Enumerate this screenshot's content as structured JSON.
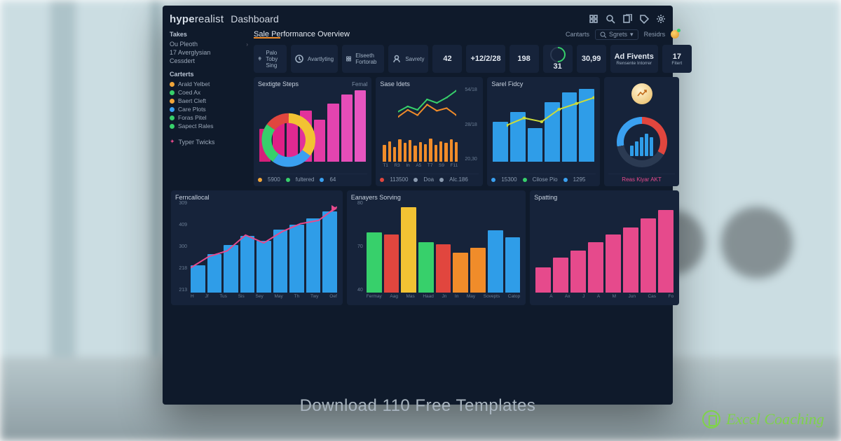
{
  "brand": {
    "prefix": "hype",
    "mid": "realist"
  },
  "title": "Dashboard",
  "subtitle": "Sale Performance Overview",
  "header_right": {
    "link1": "Cantarts",
    "search_label": "Sgrets",
    "link2": "Residrs"
  },
  "sidebar": {
    "sec1_title": "Takes",
    "sec1_items": [
      "Ou Pleoth",
      "17 Averglysian",
      "Cessdert"
    ],
    "sec2_title": "Carterts",
    "legend_items": [
      {
        "label": "Arald Yelbet",
        "color": "#f0a53a"
      },
      {
        "label": "Coed Ax",
        "color": "#37d06b"
      },
      {
        "label": "Baert Cleft",
        "color": "#f0a53a"
      },
      {
        "label": "Care Plots",
        "color": "#3aa0f0"
      },
      {
        "label": "Foras Pitel",
        "color": "#37d06b"
      },
      {
        "label": "Sapect Rales",
        "color": "#37d06b"
      }
    ],
    "footer_item": "Typer Twicks"
  },
  "kpis": [
    {
      "icon": "pin",
      "label": "Palo Toby Sing"
    },
    {
      "icon": "clock",
      "label": "Avartlyting"
    },
    {
      "icon": "grid",
      "label": "Elseeth Fortorab"
    },
    {
      "icon": "user",
      "label": "Savrety"
    },
    {
      "big": "42",
      "sub": ""
    },
    {
      "big": "+12/2/28",
      "sub": ""
    },
    {
      "big": "198",
      "sub": ""
    },
    {
      "gauge": true,
      "big": "31",
      "sub": ""
    },
    {
      "big": "30,99",
      "sub": ""
    },
    {
      "big": "Ad Fivents",
      "sub": "Rensente Intorrer"
    },
    {
      "big": "17",
      "sub": "Fitert"
    }
  ],
  "panels": {
    "p1": {
      "title": "Sextigte Steps",
      "right": "Femal",
      "foot": [
        {
          "c": "#f0a53a",
          "t": "5900"
        },
        {
          "c": "#37d06b",
          "t": "fultered"
        },
        {
          "c": "#3aa0f0",
          "t": "64"
        }
      ]
    },
    "p2": {
      "title": "Sase Idets",
      "foot": [
        {
          "c": "#e1463e",
          "t": "113500"
        },
        {
          "c": "#8b9bb0",
          "t": "Doa"
        },
        {
          "c": "#8b9bb0",
          "t": "Alc.186"
        }
      ]
    },
    "p3": {
      "title": "Sarel Fidcy",
      "foot": [
        {
          "c": "#3aa0f0",
          "t": "15300"
        },
        {
          "c": "#37d06b",
          "t": "Cilose Pio"
        },
        {
          "c": "#3aa0f0",
          "t": "1295"
        }
      ]
    },
    "p4": {
      "title": "",
      "foot_text": "Reas Kiyar AKT"
    },
    "p5": {
      "title": "Ferncallocal"
    },
    "p6": {
      "title": "Eanayers Sorving"
    },
    "p7": {
      "title": "Spatting"
    }
  },
  "banner": "Download  110  Free Templates",
  "brandmark": "Excel Coaching",
  "colors": {
    "pink": "#e64a8c",
    "blue": "#2f9de8",
    "orange": "#f08c2a",
    "red": "#e1463e",
    "green": "#37d06b",
    "yellow": "#f2c233",
    "teal": "#2bb8a3",
    "lime": "#8bc34a"
  },
  "chart_data": [
    {
      "id": "p1_bars",
      "type": "bar",
      "title": "Sextigte Steps",
      "values": [
        45,
        55,
        62,
        70,
        58,
        80,
        92,
        98
      ],
      "ylim": [
        0,
        100
      ],
      "colors_from": "pink_gradient",
      "overlay_donut": {
        "slices": [
          35,
          25,
          25,
          15
        ],
        "colors": [
          "#f2c233",
          "#3aa0f0",
          "#37d06b",
          "#e1463e"
        ]
      }
    },
    {
      "id": "p2_lines",
      "type": "line",
      "title": "Sase Idets",
      "x": [
        "T1",
        "R3",
        "In",
        "A5",
        "T7",
        "S9",
        "F11"
      ],
      "series": [
        {
          "name": "green",
          "values": [
            34,
            40,
            36,
            48,
            44,
            50,
            58
          ],
          "color": "#37d06b"
        },
        {
          "name": "orange",
          "values": [
            28,
            36,
            30,
            42,
            35,
            38,
            30
          ],
          "color": "#f08c2a"
        }
      ],
      "ylabels": [
        "54/18",
        "28/18",
        "20,30"
      ],
      "ylim": [
        20,
        60
      ],
      "bars_below": {
        "values": [
          18,
          22,
          16,
          24,
          20,
          23,
          17,
          21,
          19,
          25,
          18,
          22,
          20,
          24,
          21
        ],
        "color": "#f08c2a"
      }
    },
    {
      "id": "p3_combo",
      "type": "bar",
      "title": "Sarel Fidcy",
      "values": [
        55,
        68,
        46,
        82,
        95,
        100
      ],
      "ylim": [
        0,
        100
      ],
      "color": "#2f9de8",
      "line_overlay": {
        "values": [
          50,
          60,
          55,
          72,
          80,
          88
        ],
        "color": "#cddc39"
      }
    },
    {
      "id": "p4_gauge",
      "type": "pie",
      "title": "",
      "gauge_pct": 65,
      "segments": [
        "#e1463e",
        "#2b3a52",
        "#3aa0f0"
      ],
      "inner_bars": [
        40,
        55,
        70,
        85,
        72
      ],
      "inner_color": "#2f9de8",
      "badge_icon": "trend-up"
    },
    {
      "id": "p5_trend",
      "type": "bar",
      "title": "Ferncallocal",
      "categories": [
        "H",
        "Jf",
        "Tus",
        "Sis",
        "Sey",
        "May",
        "Th",
        "Twy",
        "Oef"
      ],
      "values": [
        120,
        170,
        210,
        250,
        230,
        280,
        300,
        330,
        360
      ],
      "ylabels": [
        "309",
        "409",
        "300",
        "218",
        "213"
      ],
      "ylim": [
        0,
        400
      ],
      "color": "#2f9de8",
      "trend_line": {
        "values": [
          110,
          160,
          185,
          255,
          220,
          270,
          305,
          320,
          380
        ],
        "color": "#e64a8c"
      }
    },
    {
      "id": "p6_multi",
      "type": "bar",
      "title": "Eanayers Sorving",
      "categories": [
        "Fermay",
        "Aag",
        "Mas",
        "Haad",
        "Jn",
        "In",
        "May",
        "Sovepts",
        "Catop"
      ],
      "values": [
        60,
        58,
        85,
        50,
        48,
        40,
        45,
        62,
        55
      ],
      "colors": [
        "#37d06b",
        "#e1463e",
        "#f2c233",
        "#37d06b",
        "#e1463e",
        "#f08c2a",
        "#f08c2a",
        "#2f9de8",
        "#2f9de8"
      ],
      "ylabels": [
        "80",
        "70",
        "40"
      ],
      "ylim": [
        0,
        90
      ]
    },
    {
      "id": "p7_pink",
      "type": "bar",
      "title": "Spatting",
      "categories": [
        "A",
        "Ax",
        "J",
        "A",
        "M",
        "Jun",
        "Cas",
        "Fo"
      ],
      "values": [
        25,
        35,
        42,
        50,
        58,
        65,
        74,
        82
      ],
      "ylim": [
        0,
        90
      ],
      "color": "#e64a8c"
    }
  ]
}
